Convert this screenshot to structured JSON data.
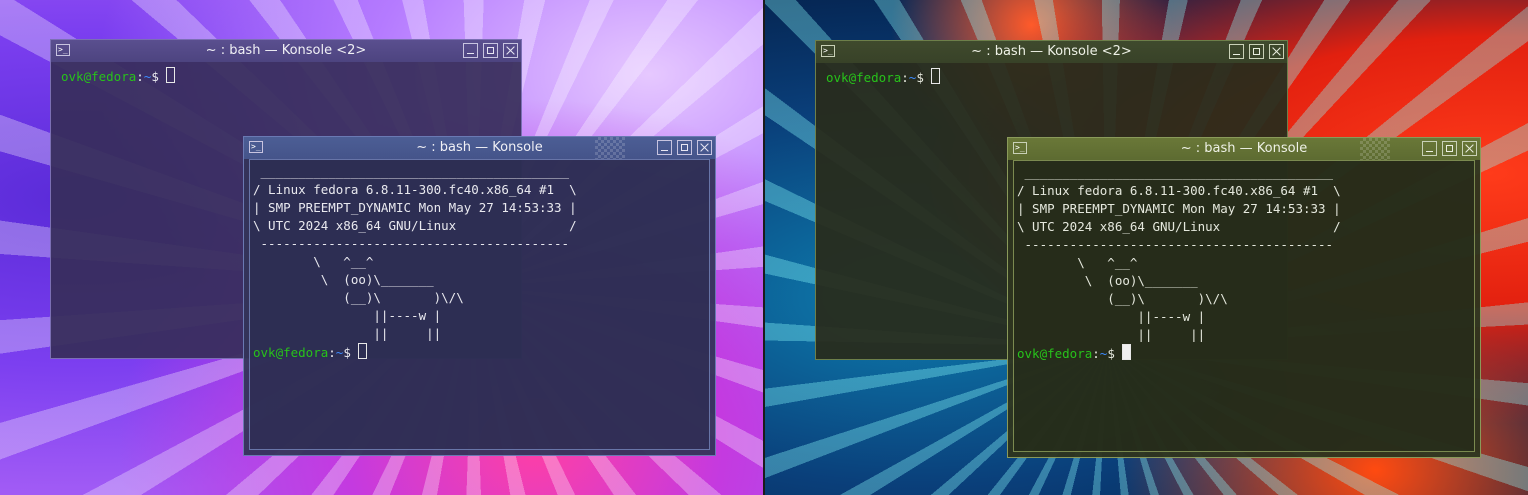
{
  "desktops": [
    {
      "theme": "purple",
      "back_window": {
        "title": "~ : bash — Konsole <2>",
        "prompt_user": "ovk@fedora",
        "prompt_sep": ":",
        "prompt_path": "~",
        "prompt_end": "$ "
      },
      "front_window": {
        "title": "~ : bash — Konsole",
        "output": " _________________________________________\n/ Linux fedora 6.8.11-300.fc40.x86_64 #1  \\\n| SMP PREEMPT_DYNAMIC Mon May 27 14:53:33 |\n\\ UTC 2024 x86_64 GNU/Linux               /\n -----------------------------------------\n        \\   ^__^\n         \\  (oo)\\_______\n            (__)\\       )\\/\\\n                ||----w |\n                ||     ||",
        "prompt_user": "ovk@fedora",
        "prompt_sep": ":",
        "prompt_path": "~",
        "prompt_end": "$ "
      }
    },
    {
      "theme": "green",
      "back_window": {
        "title": "~ : bash — Konsole <2>",
        "prompt_user": "ovk@fedora",
        "prompt_sep": ":",
        "prompt_path": "~",
        "prompt_end": "$ "
      },
      "front_window": {
        "title": "~ : bash — Konsole",
        "output": " _________________________________________\n/ Linux fedora 6.8.11-300.fc40.x86_64 #1  \\\n| SMP PREEMPT_DYNAMIC Mon May 27 14:53:33 |\n\\ UTC 2024 x86_64 GNU/Linux               /\n -----------------------------------------\n        \\   ^__^\n         \\  (oo)\\_______\n            (__)\\       )\\/\\\n                ||----w |\n                ||     ||",
        "prompt_user": "ovk@fedora",
        "prompt_sep": ":",
        "prompt_path": "~",
        "prompt_end": "$ "
      }
    }
  ],
  "icons": {
    "window_icon": "terminal-icon",
    "minimize": "minimize-icon",
    "maximize": "maximize-icon",
    "close": "close-icon"
  },
  "colors": {
    "prompt_user": "#27c21a",
    "prompt_path": "#3c8bff"
  }
}
